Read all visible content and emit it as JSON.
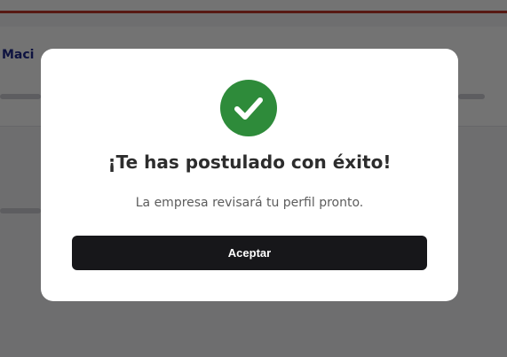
{
  "modal": {
    "icon": "check-circle-icon",
    "title": "¡Te has postulado con éxito!",
    "message": "La empresa revisará tu perfil pronto.",
    "accept_label": "Aceptar"
  },
  "colors": {
    "success": "#2e8b3a",
    "button": "#17171a",
    "overlay": "rgba(0,0,0,0.55)",
    "top_accent": "#c0392b",
    "background_title": "#1f2b8f"
  }
}
